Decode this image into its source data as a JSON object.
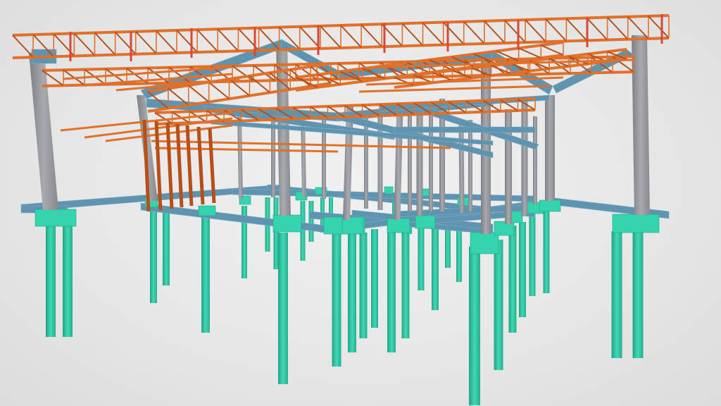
{
  "viewer": {
    "background": "#e8e8e8"
  },
  "model": {
    "description_colors": {
      "truss": "#e0702a",
      "truss_dark": "#b84f18",
      "truss_red": "#d8483a",
      "column": "#8e9196",
      "column_light": "#a9acb0",
      "beam": "#5e94b0",
      "beam_light": "#7fb0c8",
      "pile": "#2ec6a4",
      "pile_dark": "#22a386",
      "pile_cap": "#33d4ae"
    }
  }
}
